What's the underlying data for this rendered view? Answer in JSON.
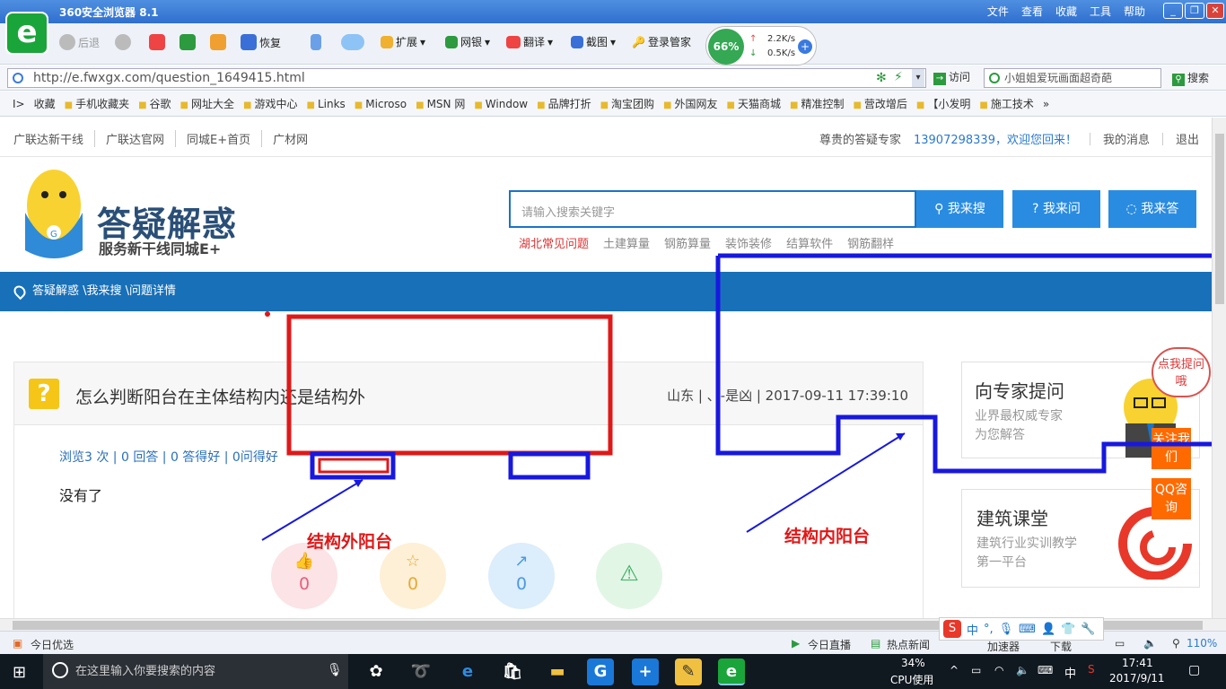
{
  "browser": {
    "title": "360安全浏览器 8.1",
    "menu": [
      "文件",
      "查看",
      "收藏",
      "工具",
      "帮助"
    ],
    "toolbar": {
      "back": "后退",
      "restore": "恢复",
      "extend": "扩展",
      "netbank": "网银",
      "translate": "翻译",
      "screenshot": "截图",
      "login": "登录管家"
    },
    "speed": {
      "percent": "66%",
      "up": "2.2K/s",
      "down": "0.5K/s"
    },
    "url": "http://e.fwxgx.com/question_1649415.html",
    "visit_label": "访问",
    "search_placeholder": "小姐姐爱玩画面超奇葩",
    "search_label": "搜索",
    "bookmarks": [
      "收藏",
      "手机收藏夹",
      "谷歌",
      "网址大全",
      "游戏中心",
      "Links",
      "Microso",
      "MSN 网",
      "Window",
      "品牌打折",
      "淘宝团购",
      "外国网友",
      "天猫商城",
      "精准控制",
      "营改增后",
      "【小发明",
      "施工技术"
    ]
  },
  "site": {
    "topnav_left": [
      "广联达新干线",
      "广联达官网",
      "同城E+首页",
      "广材网"
    ],
    "topnav_right": {
      "role": "尊贵的答疑专家",
      "user": "13907298339，欢迎您回来！",
      "messages": "我的消息",
      "logout": "退出"
    },
    "brand": {
      "title": "答疑解惑",
      "subtitle": "服务新干线同城E+"
    },
    "search": {
      "placeholder": "请输入搜索关键字",
      "btn_search": "我来搜",
      "btn_ask": "我来问",
      "btn_answer": "我来答"
    },
    "hot_links": [
      "湖北常见问题",
      "土建算量",
      "钢筋算量",
      "装饰装修",
      "结算软件",
      "钢筋翻样"
    ],
    "breadcrumb": "答疑解惑 \\我来搜 \\问题详情",
    "question": {
      "title": "怎么判断阳台在主体结构内还是结构外",
      "meta": "山东 | 、-是凶 | 2017-09-11 17:39:10",
      "stats": "浏览3 次 | 0 回答 | 0 答得好 | 0问得好",
      "body": "没有了",
      "actions": [
        {
          "icon": "thumb-up-icon",
          "count": "0",
          "color": "#fbe3e6",
          "fg": "#e8607a"
        },
        {
          "icon": "star-icon",
          "count": "0",
          "color": "#fdf0d6",
          "fg": "#e6a93a"
        },
        {
          "icon": "share-icon",
          "count": "0",
          "color": "#dcedfb",
          "fg": "#4a9be0"
        },
        {
          "icon": "warning-icon",
          "count": "",
          "color": "#e2f6e6",
          "fg": "#3cb060"
        }
      ]
    },
    "sidebar": {
      "ask_expert": {
        "title": "向专家提问",
        "sub": "业界最权威专家为您解答"
      },
      "course": {
        "title": "建筑课堂",
        "sub": "建筑行业实训教学第一平台"
      },
      "bubble": "点我提问哦",
      "follow": "关注我们",
      "qq": "QQ咨询"
    },
    "annotations": {
      "outside": "结构外阳台",
      "inside": "结构内阳台"
    }
  },
  "statusbar": {
    "left": "今日优选",
    "live": "今日直播",
    "news": "热点新闻",
    "speedup": "加速器",
    "download": "下载",
    "zoom": "110%"
  },
  "taskbar": {
    "search": "在这里输入你要搜索的内容",
    "cpu_percent": "34%",
    "cpu_label": "CPU使用",
    "ime": "中",
    "time": "17:41",
    "date": "2017/9/11"
  }
}
